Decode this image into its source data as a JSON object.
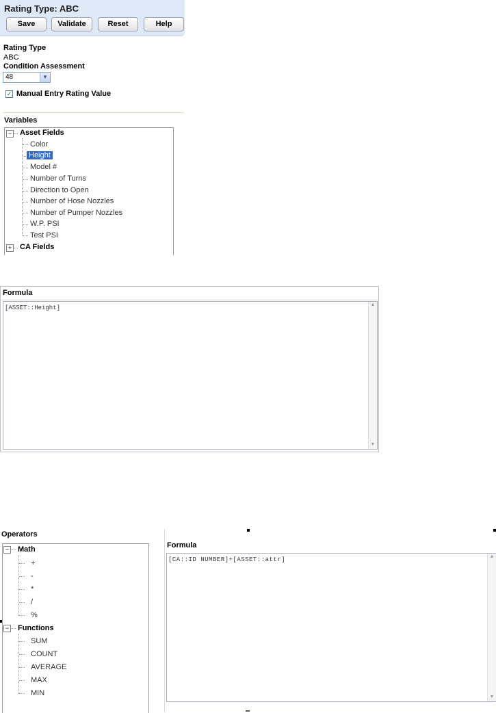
{
  "header": {
    "title": "Rating Type: ABC",
    "buttons": {
      "save": "Save",
      "validate": "Validate",
      "reset": "Reset",
      "help": "Help"
    }
  },
  "form": {
    "rating_type_label": "Rating Type",
    "rating_type_value": "ABC",
    "condition_label": "Condition Assessment",
    "condition_value": "48",
    "manual_entry_label": "Manual Entry Rating Value",
    "manual_entry_checked": true
  },
  "variables": {
    "title": "Variables",
    "asset_fields_label": "Asset Fields",
    "asset_fields_items": [
      "Color",
      "Height",
      "Model #",
      "Number of Turns",
      "Direction to Open",
      "Number of Hose Nozzles",
      "Number of Pumper Nozzles",
      "W.P. PSI",
      "Test PSI"
    ],
    "selected_item": "Height",
    "ca_fields_label": "CA Fields"
  },
  "formula_panel": {
    "title": "Formula",
    "value": "[ASSET::Height]"
  },
  "operators": {
    "title": "Operators",
    "math_label": "Math",
    "math_items": [
      "+",
      "-",
      "*",
      "/",
      "%"
    ],
    "functions_label": "Functions",
    "function_items": [
      "SUM",
      "COUNT",
      "AVERAGE",
      "MAX",
      "MIN"
    ]
  },
  "formula_panel_2": {
    "title": "Formula",
    "value": "[CA::ID NUMBER]+[ASSET::attr]"
  },
  "colors": {
    "header_bg": "#dfe8f6",
    "selection": "#316ac5"
  }
}
